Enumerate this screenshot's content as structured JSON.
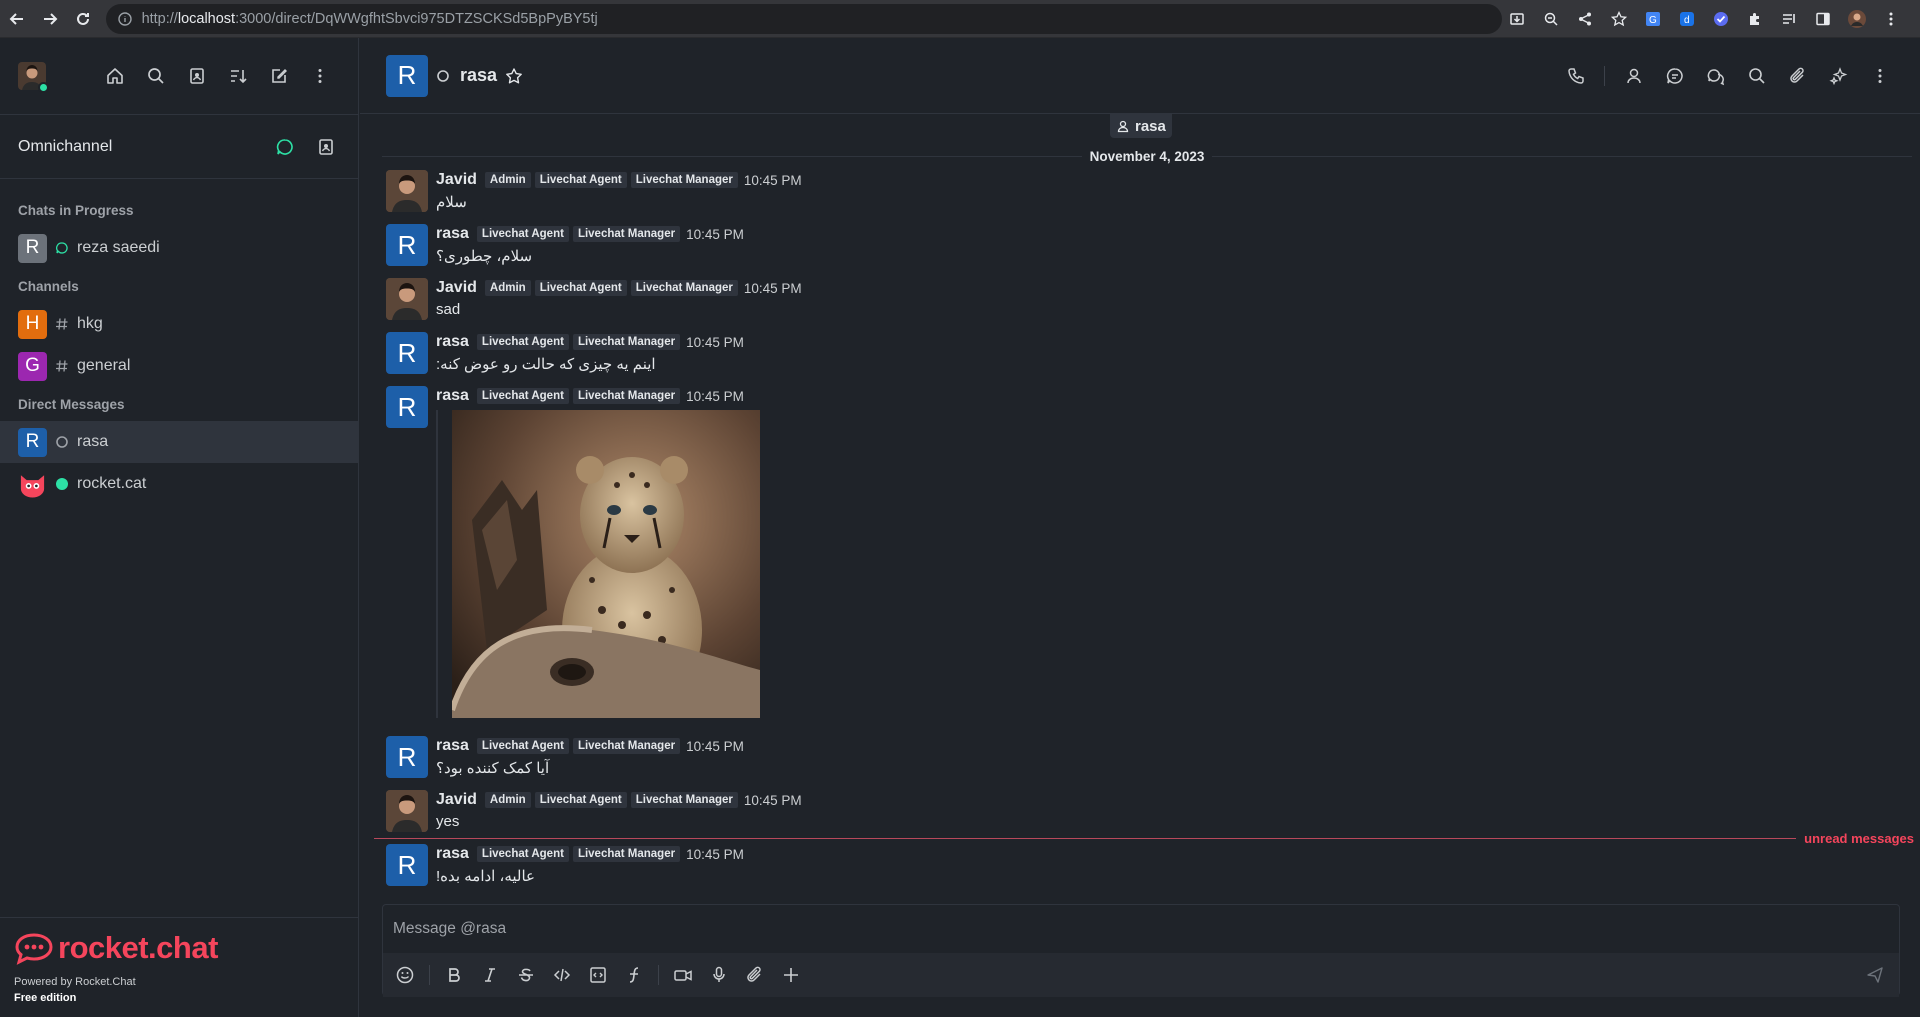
{
  "browser": {
    "url_prefix": "http://",
    "url_host": "localhost",
    "url_rest": ":3000/direct/DqWWgfhtSbvci975DTZSCKSd5BpPyBY5tj"
  },
  "sidebar": {
    "section_title": "Omnichannel",
    "groups": [
      {
        "title": "Chats in Progress"
      },
      {
        "title": "Channels"
      },
      {
        "title": "Direct Messages"
      }
    ],
    "items": [
      {
        "avatar": "R",
        "label": "reza saeedi",
        "color": "#6c727a"
      },
      {
        "avatar": "H",
        "label": "hkg",
        "color": "#e26d0e"
      },
      {
        "avatar": "G",
        "label": "general",
        "color": "#9c27b0"
      },
      {
        "avatar": "R",
        "label": "rasa",
        "color": "#1d5fa9"
      },
      {
        "label": "rocket.cat"
      }
    ],
    "brand": {
      "logo": "rocket.chat",
      "powered": "Powered by Rocket.Chat",
      "edition": "Free edition"
    }
  },
  "room": {
    "avatar": "R",
    "title": "rasa",
    "chip_label": "rasa",
    "date_divider": "November 4, 2023",
    "unread_label": "unread messages",
    "composer_placeholder": "Message @rasa"
  },
  "messages": [
    {
      "user": "Javid",
      "roles": [
        "Admin",
        "Livechat Agent",
        "Livechat Manager"
      ],
      "time": "10:45 PM",
      "text": "سلام"
    },
    {
      "user": "rasa",
      "avatar": "R",
      "roles": [
        "Livechat Agent",
        "Livechat Manager"
      ],
      "time": "10:45 PM",
      "text": "سلام، چطوری؟"
    },
    {
      "user": "Javid",
      "roles": [
        "Admin",
        "Livechat Agent",
        "Livechat Manager"
      ],
      "time": "10:45 PM",
      "text": "sad"
    },
    {
      "user": "rasa",
      "avatar": "R",
      "roles": [
        "Livechat Agent",
        "Livechat Manager"
      ],
      "time": "10:45 PM",
      "text": "اینم یه چیزی که حالت رو عوض کنه:"
    },
    {
      "user": "rasa",
      "avatar": "R",
      "roles": [
        "Livechat Agent",
        "Livechat Manager"
      ],
      "time": "10:45 PM",
      "image": "cheetah-cub"
    },
    {
      "user": "rasa",
      "avatar": "R",
      "roles": [
        "Livechat Agent",
        "Livechat Manager"
      ],
      "time": "10:45 PM",
      "text": "آیا کمک کننده بود؟"
    },
    {
      "user": "Javid",
      "roles": [
        "Admin",
        "Livechat Agent",
        "Livechat Manager"
      ],
      "time": "10:45 PM",
      "text": "yes"
    },
    {
      "user": "rasa",
      "avatar": "R",
      "roles": [
        "Livechat Agent",
        "Livechat Manager"
      ],
      "time": "10:45 PM",
      "text": "عالیه، ادامه بده!"
    }
  ],
  "colors": {
    "accent": "#f5455c",
    "online": "#2de0a5",
    "unread_line": "#b8485b"
  }
}
